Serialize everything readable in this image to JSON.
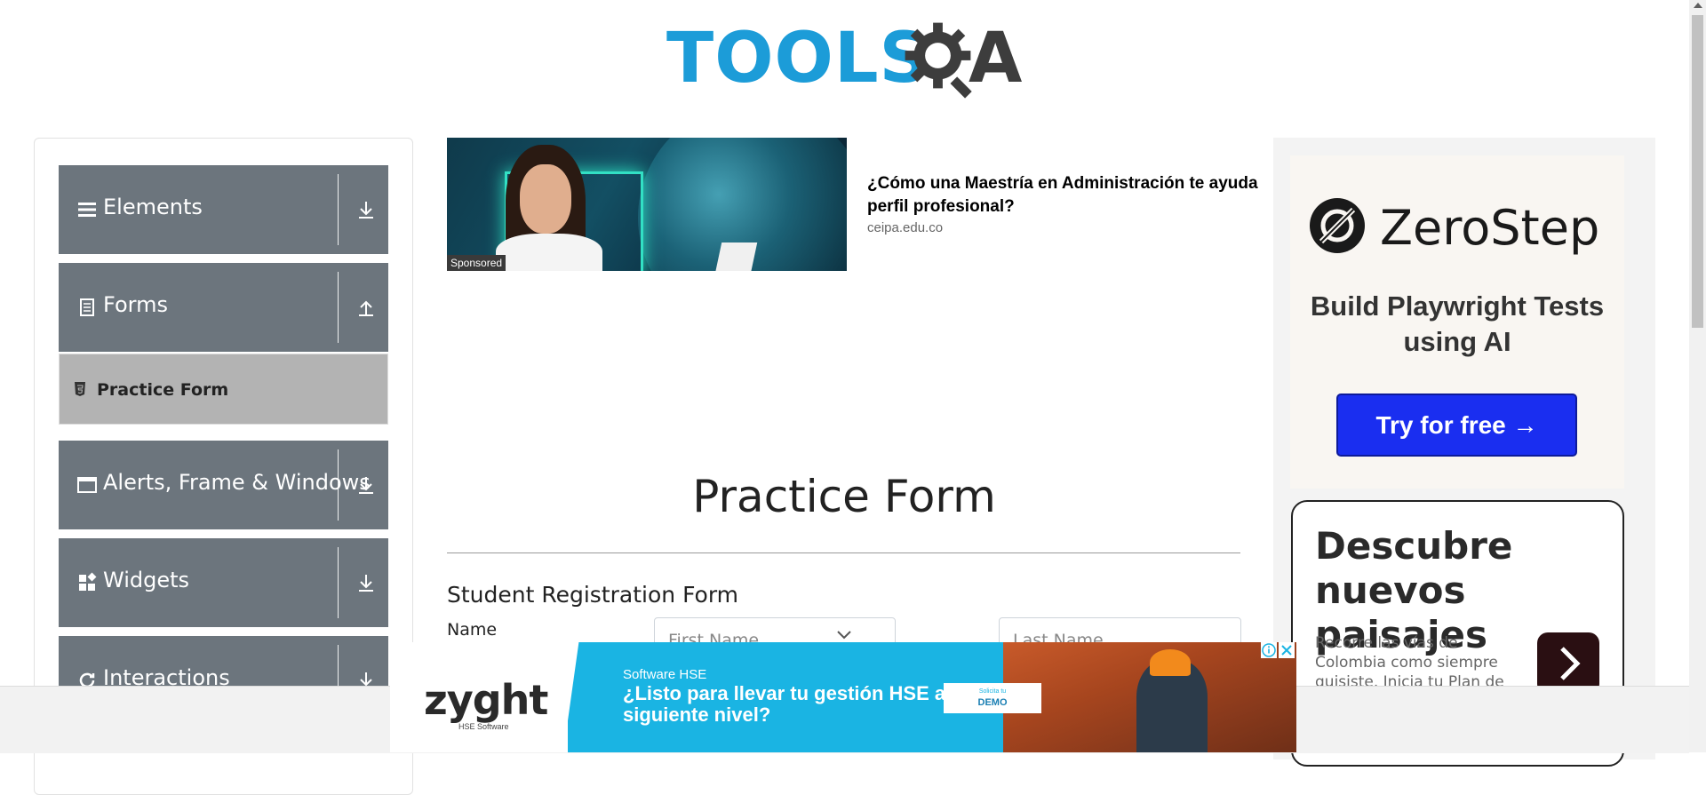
{
  "header": {
    "logo_text": "TOOLS",
    "logo_text_end": "A"
  },
  "sidebar": {
    "groups": [
      {
        "label": "Elements",
        "icon": "hamburger-icon",
        "state": "collapsed"
      },
      {
        "label": "Forms",
        "icon": "document-icon",
        "state": "expanded"
      },
      {
        "label": "Alerts, Frame & Windows",
        "icon": "window-icon",
        "state": "collapsed"
      },
      {
        "label": "Widgets",
        "icon": "widgets-icon",
        "state": "collapsed"
      },
      {
        "label": "Interactions",
        "icon": "refresh-icon",
        "state": "collapsed"
      }
    ],
    "active_item": {
      "label": "Practice Form",
      "icon": "html5-icon"
    }
  },
  "ad_top": {
    "badge": "Sponsored",
    "title": "¿Cómo una Maestría en Administración te ayuda a... perfil profesional?",
    "title_line1": "¿Cómo una Maestría en Administración te ayuda",
    "title_line2": "perfil profesional?",
    "domain": "ceipa.edu.co"
  },
  "main": {
    "page_title": "Practice Form",
    "form_heading": "Student Registration Form",
    "name_label": "Name",
    "first_name_placeholder": "First Name",
    "last_name_placeholder": "Last Name"
  },
  "ad_right": {
    "brand": "ZeroStep",
    "tagline": "Build Playwright Tests using AI",
    "cta": "Try for free →",
    "card_title": "Descubre nuevos paisajes",
    "card_body": "Recorre las vías de Colombia como siempre quisiste. Inicia tu Plan de Ahorro Programado."
  },
  "ad_bottom": {
    "brand": "zyght",
    "brand_sub": "HSE Software",
    "kicker": "Software HSE",
    "headline": "¿Listo para llevar tu gestión HSE al siguiente nivel?",
    "cta_small": "Solicita tu",
    "cta": "DEMO"
  },
  "colors": {
    "sidebar_group": "#6c757d",
    "sidebar_active": "#b3b3b3",
    "logo_blue": "#1c9cd8",
    "cta_blue": "#1a2ef0",
    "ad_blue": "#1ab4e3"
  }
}
